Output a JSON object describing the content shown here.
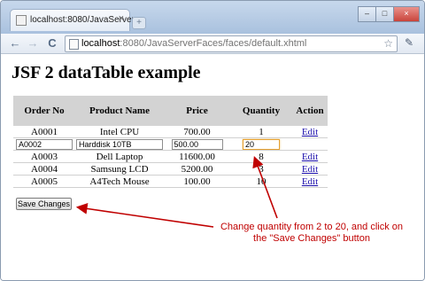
{
  "browser": {
    "tab_title": "localhost:8080/JavaServer...",
    "tab_close": "×",
    "new_tab": "+",
    "window_controls": {
      "minimize": "–",
      "maximize": "□",
      "close": "×"
    },
    "nav": {
      "back": "←",
      "forward": "→",
      "reload": "C"
    },
    "url_host": "localhost",
    "url_path": ":8080/JavaServerFaces/faces/default.xhtml",
    "bookmark_icon": "☆",
    "wrench_icon": "✎"
  },
  "page": {
    "heading": "JSF 2 dataTable example",
    "table": {
      "headers": {
        "order_no": "Order No",
        "product_name": "Product Name",
        "price": "Price",
        "quantity": "Quantity",
        "action": "Action"
      },
      "rows": [
        {
          "order_no": "A0001",
          "product_name": "Intel CPU",
          "price": "700.00",
          "quantity": "1",
          "action": "Edit"
        },
        {
          "order_no": "A0002",
          "product_name": "Harddisk 10TB",
          "price": "500.00",
          "quantity": "20",
          "action": ""
        },
        {
          "order_no": "A0003",
          "product_name": "Dell Laptop",
          "price": "11600.00",
          "quantity": "8",
          "action": "Edit"
        },
        {
          "order_no": "A0004",
          "product_name": "Samsung LCD",
          "price": "5200.00",
          "quantity": "3",
          "action": "Edit"
        },
        {
          "order_no": "A0005",
          "product_name": "A4Tech Mouse",
          "price": "100.00",
          "quantity": "10",
          "action": "Edit"
        }
      ]
    },
    "save_button": "Save Changes",
    "annotation": "Change quantity from 2 to 20, and click on the \"Save Changes\" button",
    "annotation_color": "#c00000"
  }
}
